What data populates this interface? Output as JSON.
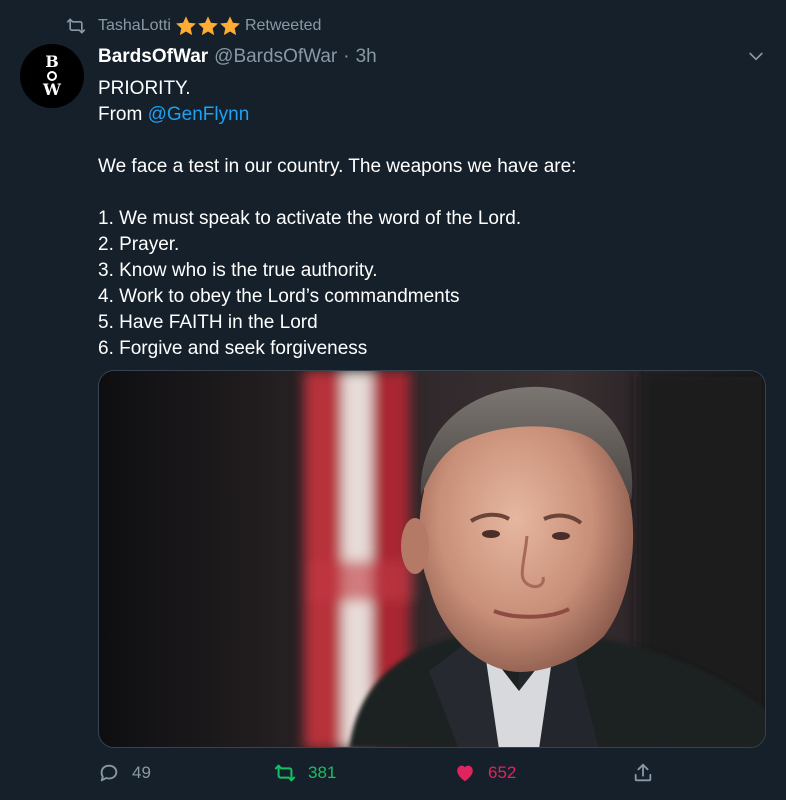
{
  "retweet_context": {
    "user": "TashaLotti",
    "stars": [
      "★",
      "★",
      "★"
    ],
    "label": "Retweeted",
    "star_color": "#ffac33"
  },
  "tweet": {
    "avatar_letters": [
      "B",
      "W"
    ],
    "display_name": "BardsOfWar",
    "handle": "@BardsOfWar",
    "separator": "·",
    "time": "3h",
    "text_lines": [
      {
        "text": "PRIORITY."
      },
      {
        "prefix": "From ",
        "mention": "@GenFlynn"
      },
      {
        "text": ""
      },
      {
        "text": "We face a test in our country. The weapons we have are:"
      },
      {
        "text": ""
      },
      {
        "text": "1. We must speak to activate the word of the Lord."
      },
      {
        "text": "2. Prayer."
      },
      {
        "text": "3. Know who is the true authority."
      },
      {
        "text": "4. Work to obey the Lord’s commandments"
      },
      {
        "text": "5. Have FAITH in the Lord"
      },
      {
        "text": "6. Forgive and seek forgiveness"
      }
    ],
    "media_icon": "photo-of-man-in-front-of-flag"
  },
  "actions": {
    "reply_count": "49",
    "retweet_count": "381",
    "like_count": "652",
    "retweet_color": "#17bf63",
    "like_color": "#e0245e"
  },
  "colors": {
    "background": "#15202b",
    "secondary_text": "#8899a6",
    "link": "#1da1f2"
  }
}
